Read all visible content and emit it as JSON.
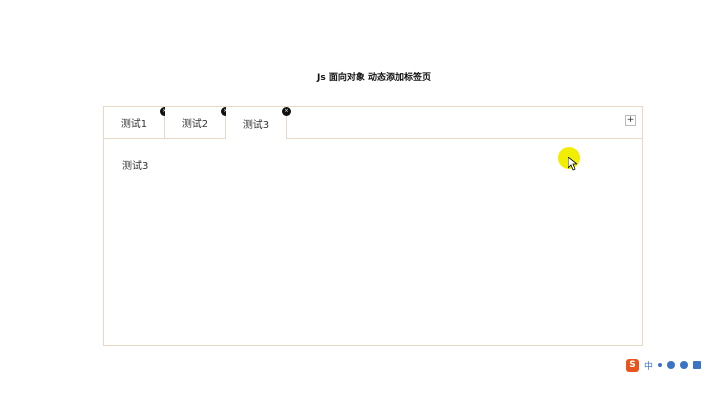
{
  "page": {
    "title": "Js 面向对象 动态添加标签页"
  },
  "tabs": [
    {
      "label": "测试1",
      "active": false
    },
    {
      "label": "测试2",
      "active": false
    },
    {
      "label": "测试3",
      "active": true
    }
  ],
  "add_tab_label": "+",
  "close_label": "×",
  "panel": {
    "content": "测试3"
  },
  "taskbar": {
    "logo_label": "S",
    "language_label": "中"
  },
  "colors": {
    "border": "#e8d9c6",
    "highlight": "#f2ee00",
    "ime_accent": "#3b73c6",
    "ime_logo": "#e8541d"
  },
  "icons": [
    "close-icon",
    "plus-icon",
    "cursor-icon",
    "sogou-ime-icon"
  ]
}
